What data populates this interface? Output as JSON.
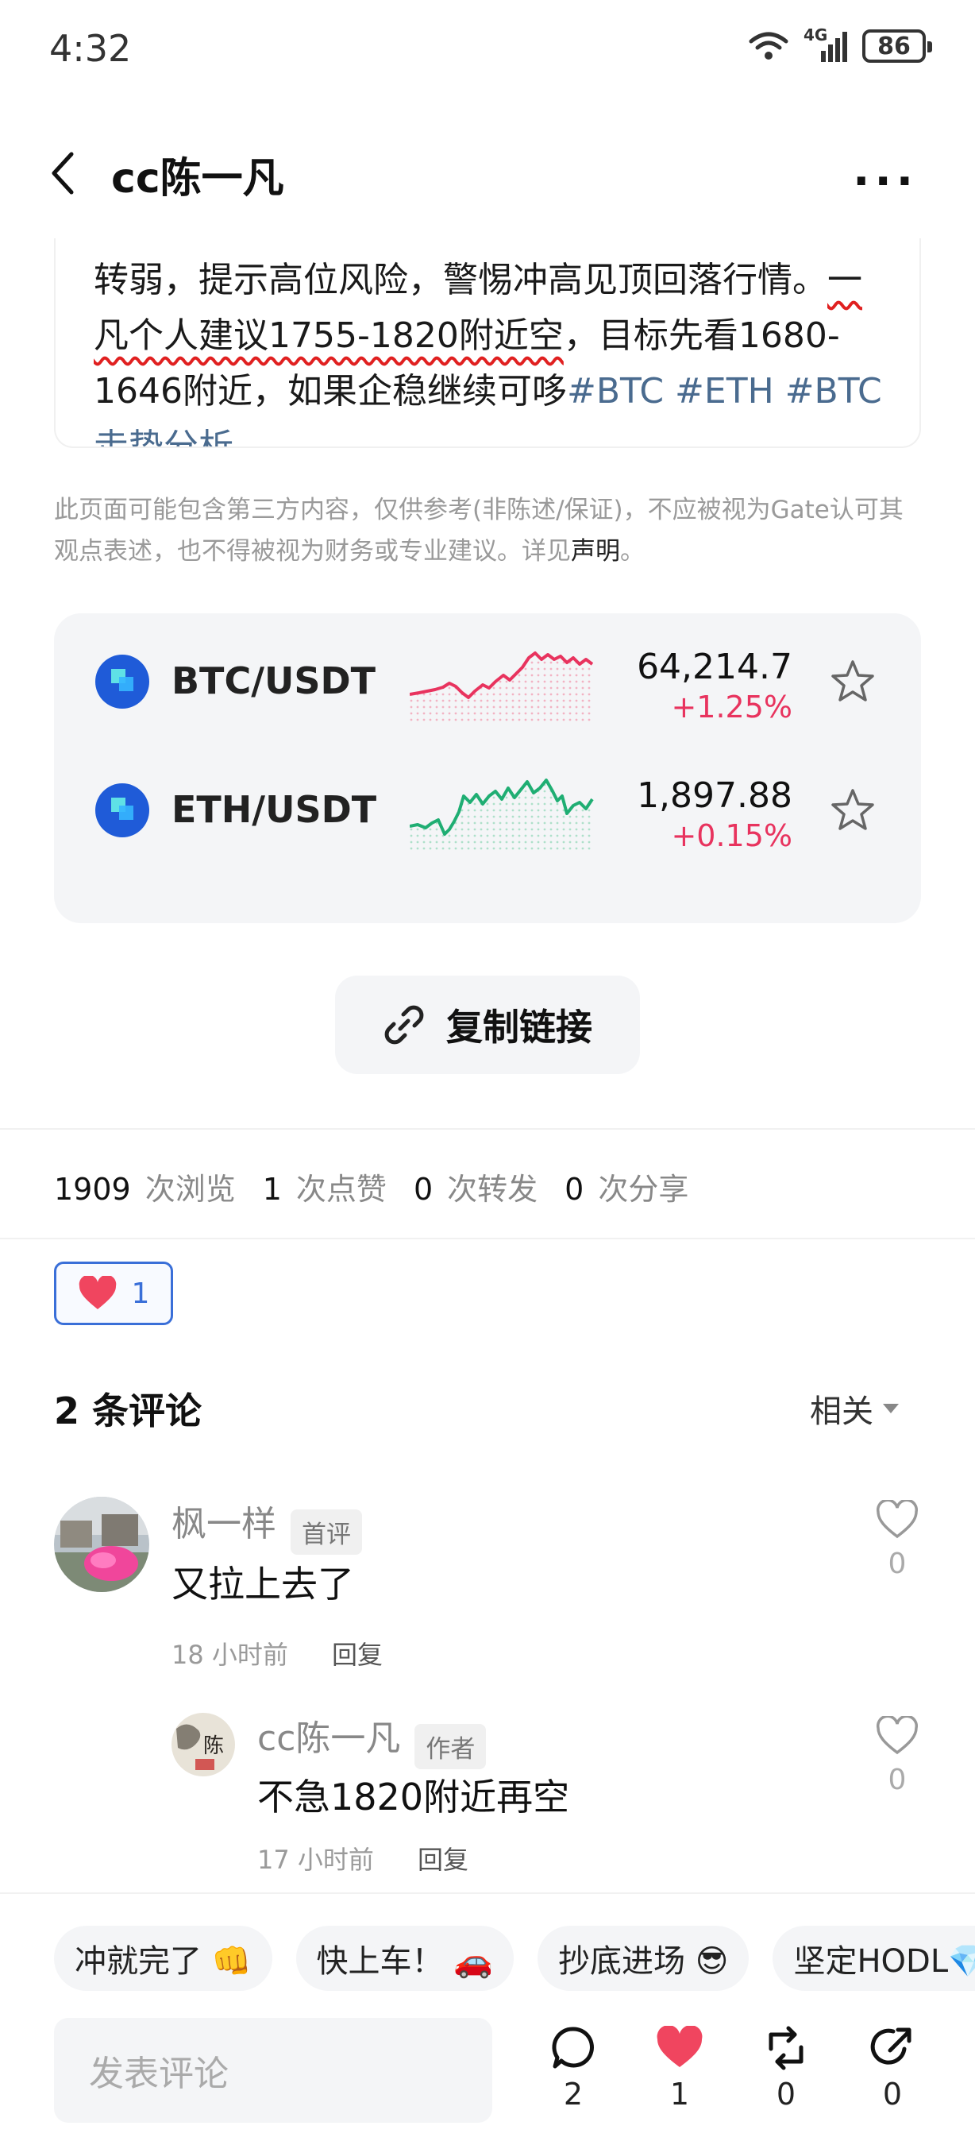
{
  "status_bar": {
    "time": "4:32",
    "network": "4G",
    "battery": "86"
  },
  "header": {
    "title": "cc陈一凡",
    "more": "···"
  },
  "article": {
    "text_before": "转弱，提示高位风险，警惕冲高见顶回落行情。",
    "text_highlight": "一凡个人建议1755-1820附近空",
    "text_after": "，目标先看1680-1646附近，如果企稳继续可哆",
    "tags": "#BTC #ETH #BTC走势分析"
  },
  "disclaimer": {
    "text": "此页面可能包含第三方内容，仅供参考(非陈述/保证)，不应被视为Gate认可其观点表述，也不得被视为财务或专业建议。详见",
    "link": "声明",
    "end": "。"
  },
  "market": [
    {
      "pair": "BTC/USDT",
      "price": "64,214.7",
      "change": "+1.25%",
      "trend_color": "#e8335e"
    },
    {
      "pair": "ETH/USDT",
      "price": "1,897.88",
      "change": "+0.15%",
      "trend_color": "#1fae73"
    }
  ],
  "copy_link": {
    "label": "复制链接"
  },
  "stats": [
    {
      "value": "1909",
      "label": "次浏览"
    },
    {
      "value": "1",
      "label": "次点赞"
    },
    {
      "value": "0",
      "label": "次转发"
    },
    {
      "value": "0",
      "label": "次分享"
    }
  ],
  "reaction": {
    "count": "1"
  },
  "comments": {
    "title": "2 条评论",
    "sort": "相关",
    "items": [
      {
        "author": "枫一样",
        "badge": "首评",
        "text": "又拉上去了",
        "time": "18 小时前",
        "reply": "回复",
        "likes": "0"
      },
      {
        "author": "cc陈一凡",
        "badge": "作者",
        "text": "不急1820附近再空",
        "time": "17 小时前",
        "reply": "回复",
        "likes": "0"
      }
    ]
  },
  "quick_replies": [
    "冲就完了 👊",
    "快上车！ 🚗",
    "抄底进场 😎",
    "坚定HODL💎"
  ],
  "bottom_bar": {
    "placeholder": "发表评论",
    "comment_count": "2",
    "like_count": "1",
    "repost_count": "0",
    "share_count": "0"
  }
}
